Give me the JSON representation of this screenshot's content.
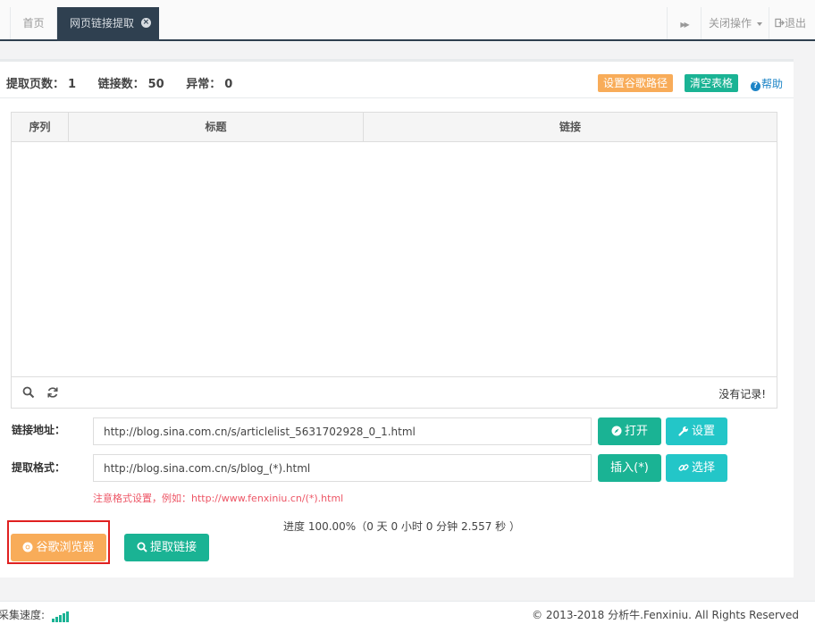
{
  "tabs": {
    "home": "首页",
    "active": "网页链接提取",
    "close_glyph": "×"
  },
  "tabbar_right": {
    "forward_glyph": "▶▶",
    "close_ops": "关闭操作",
    "logout": "退出"
  },
  "stats": {
    "pages_label": "提取页数：",
    "pages_value": "1",
    "links_label": "链接数：",
    "links_value": "50",
    "errors_label": "异常：",
    "errors_value": "0"
  },
  "toolbar": {
    "set_chrome_path": "设置谷歌路径",
    "clear_table": "清空表格",
    "help": "帮助"
  },
  "table": {
    "columns": [
      "序列",
      "标题",
      "链接"
    ],
    "empty_text": "没有记录!"
  },
  "form": {
    "url_label": "链接地址：",
    "url_value": "http://blog.sina.com.cn/s/articlelist_5631702928_0_1.html",
    "format_label": "提取格式：",
    "format_value": "http://blog.sina.com.cn/s/blog_(*).html",
    "open_button": "打开",
    "settings_button": "设置",
    "insert_button": "插入(*)",
    "select_button": "选择",
    "hint_text": "注意格式设置，例如：http://www.fenxiniu.cn/(*).html"
  },
  "progress": {
    "text": "进度 100.00%（0 天 0 小时 0 分钟 2.557 秒 ）"
  },
  "actions": {
    "chrome_browser": "谷歌浏览器",
    "extract_links": "提取链接"
  },
  "statusbar": {
    "speed_label": "采集速度:",
    "copyright": "© 2013-2018 分析牛.Fenxiniu. All Rights Reserved"
  },
  "colors": {
    "primary": "#1ab394",
    "info": "#23c6c8",
    "warning": "#f8ac59",
    "nav_dark": "#2f4050",
    "highlight": "#e02020"
  }
}
